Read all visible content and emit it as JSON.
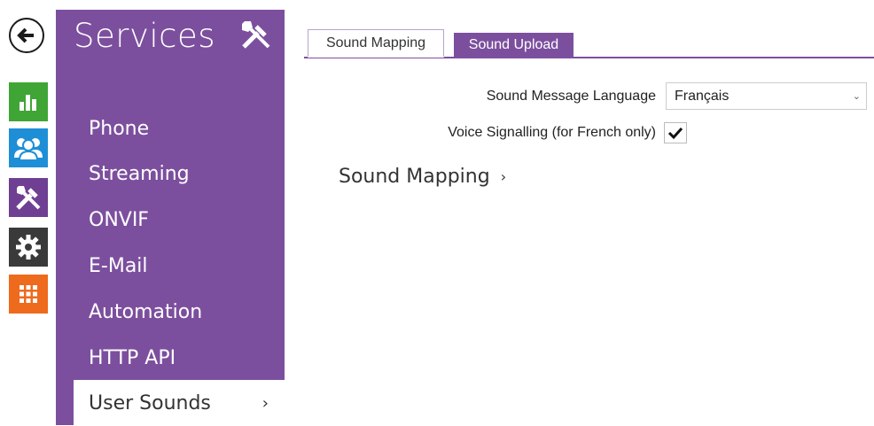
{
  "rail": {
    "back": "back-arrow-icon",
    "icons": [
      "status-icon",
      "users-icon",
      "services-icon",
      "settings-icon",
      "apps-icon"
    ],
    "colors": {
      "status": "#3fa535",
      "users": "#1e8fd6",
      "services": "#6e3f92",
      "settings": "#3a3a3a",
      "apps": "#ee6a1d"
    }
  },
  "menu": {
    "title": "Services",
    "items": [
      {
        "label": "Phone"
      },
      {
        "label": "Streaming"
      },
      {
        "label": "ONVIF"
      },
      {
        "label": "E-Mail"
      },
      {
        "label": "Automation"
      },
      {
        "label": "HTTP API"
      },
      {
        "label": "User Sounds",
        "active": true,
        "chevron": "›"
      }
    ],
    "color": "#7c4f9e"
  },
  "tabs": [
    {
      "label": "Sound Mapping",
      "active": true
    },
    {
      "label": "Sound Upload",
      "active": false
    }
  ],
  "form": {
    "language_label": "Sound Message Language",
    "language_value": "Français",
    "voice_label": "Voice Signalling (for French only)",
    "voice_checked": true
  },
  "section": {
    "label": "Sound Mapping",
    "chevron": "›"
  }
}
